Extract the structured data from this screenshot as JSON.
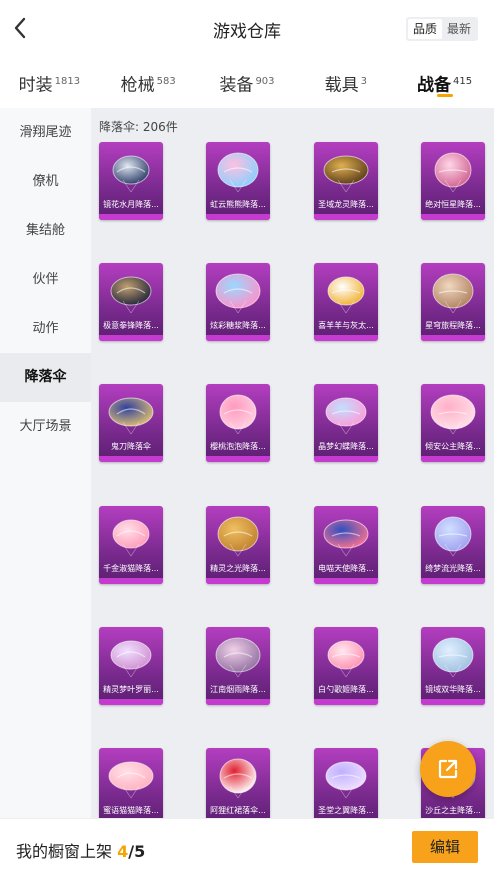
{
  "header": {
    "title": "游戏仓库",
    "sort_options": [
      "品质",
      "最新"
    ],
    "sort_active": 0
  },
  "tabs": [
    {
      "label": "时装",
      "count": "1813"
    },
    {
      "label": "枪械",
      "count": "583"
    },
    {
      "label": "装备",
      "count": "903"
    },
    {
      "label": "载具",
      "count": "3"
    },
    {
      "label": "战备",
      "count": "415",
      "active": true
    }
  ],
  "sidebar": {
    "items": [
      {
        "label": "滑翔尾迹"
      },
      {
        "label": "僚机"
      },
      {
        "label": "集结舱"
      },
      {
        "label": "伙伴"
      },
      {
        "label": "动作"
      },
      {
        "label": "降落伞",
        "active": true
      },
      {
        "label": "大厅场景"
      }
    ]
  },
  "content": {
    "count_label": "降落伞: 206件",
    "items": [
      {
        "name": "镜花水月降落...",
        "icon": "parachute-icon",
        "colors": [
          "#dfe6f0",
          "#2a3a66"
        ]
      },
      {
        "name": "虹云熊熊降落...",
        "icon": "parachute-icon",
        "colors": [
          "#ffc0e0",
          "#88d0ff"
        ]
      },
      {
        "name": "圣域龙灵降落...",
        "icon": "parachute-icon",
        "colors": [
          "#e0b050",
          "#5a3a1a"
        ]
      },
      {
        "name": "绝对恒星降落...",
        "icon": "parachute-icon",
        "colors": [
          "#ffd6e6",
          "#d06090"
        ]
      },
      {
        "name": "极意拳锋降落...",
        "icon": "parachute-icon",
        "colors": [
          "#c0a070",
          "#20243a"
        ]
      },
      {
        "name": "炫彩糖浆降落...",
        "icon": "parachute-icon",
        "colors": [
          "#9ad8ff",
          "#ff90c8"
        ]
      },
      {
        "name": "喜羊羊与灰太...",
        "icon": "parachute-icon",
        "colors": [
          "#ffffff",
          "#f0b030"
        ]
      },
      {
        "name": "星穹旅程降落...",
        "icon": "parachute-icon",
        "colors": [
          "#f0d8c0",
          "#b08060"
        ]
      },
      {
        "name": "鬼刀降落伞",
        "icon": "parachute-icon",
        "colors": [
          "#3040a0",
          "#e0c070"
        ]
      },
      {
        "name": "樱桃泡泡降落...",
        "icon": "parachute-icon",
        "colors": [
          "#ff9ac0",
          "#ffd0e0"
        ]
      },
      {
        "name": "晶梦幻蝶降落...",
        "icon": "parachute-icon",
        "colors": [
          "#c0e0ff",
          "#ff9ad8"
        ]
      },
      {
        "name": "倾安公主降落...",
        "icon": "parachute-icon",
        "colors": [
          "#ffb0c8",
          "#ffe0ea"
        ]
      },
      {
        "name": "千金淑猫降落...",
        "icon": "parachute-icon",
        "colors": [
          "#ffe0ea",
          "#ff9ab8"
        ]
      },
      {
        "name": "精灵之光降落...",
        "icon": "parachute-icon",
        "colors": [
          "#f0c060",
          "#c08030"
        ]
      },
      {
        "name": "电喵天使降落...",
        "icon": "parachute-icon",
        "colors": [
          "#3050c0",
          "#ff7090"
        ]
      },
      {
        "name": "绮梦流光降落...",
        "icon": "parachute-icon",
        "colors": [
          "#d0e0ff",
          "#a0a0f0"
        ]
      },
      {
        "name": "精灵梦叶罗丽...",
        "icon": "parachute-icon",
        "colors": [
          "#f0e0ff",
          "#d090d0"
        ]
      },
      {
        "name": "江南烟雨降落...",
        "icon": "parachute-icon",
        "colors": [
          "#f0d0e8",
          "#9070a0"
        ]
      },
      {
        "name": "白勺歌姬降落...",
        "icon": "parachute-icon",
        "colors": [
          "#ffe8f0",
          "#ff90b0"
        ]
      },
      {
        "name": "镜域双华降落...",
        "icon": "parachute-icon",
        "colors": [
          "#e0f0ff",
          "#a0c0e0"
        ]
      },
      {
        "name": "蜜语猫猫降落...",
        "icon": "parachute-icon",
        "colors": [
          "#ffe0e8",
          "#ffb0c0"
        ]
      },
      {
        "name": "阿狸红裙落伞...",
        "icon": "parachute-icon",
        "colors": [
          "#e02030",
          "#ffffff"
        ]
      },
      {
        "name": "圣堂之翼降落...",
        "icon": "parachute-icon",
        "colors": [
          "#c0b0ff",
          "#f0e0ff"
        ]
      },
      {
        "name": "沙丘之主降落...",
        "icon": "parachute-icon",
        "colors": [
          "#d0b070",
          "#806040"
        ]
      }
    ]
  },
  "fab": {
    "icon": "share-icon"
  },
  "footer": {
    "shelf_label": "我的橱窗上架",
    "shelf_current": "4",
    "shelf_sep": "/",
    "shelf_max": "5",
    "edit_label": "编辑"
  },
  "colors": {
    "accent": "#f7a21a",
    "card": "#9b35ad"
  }
}
